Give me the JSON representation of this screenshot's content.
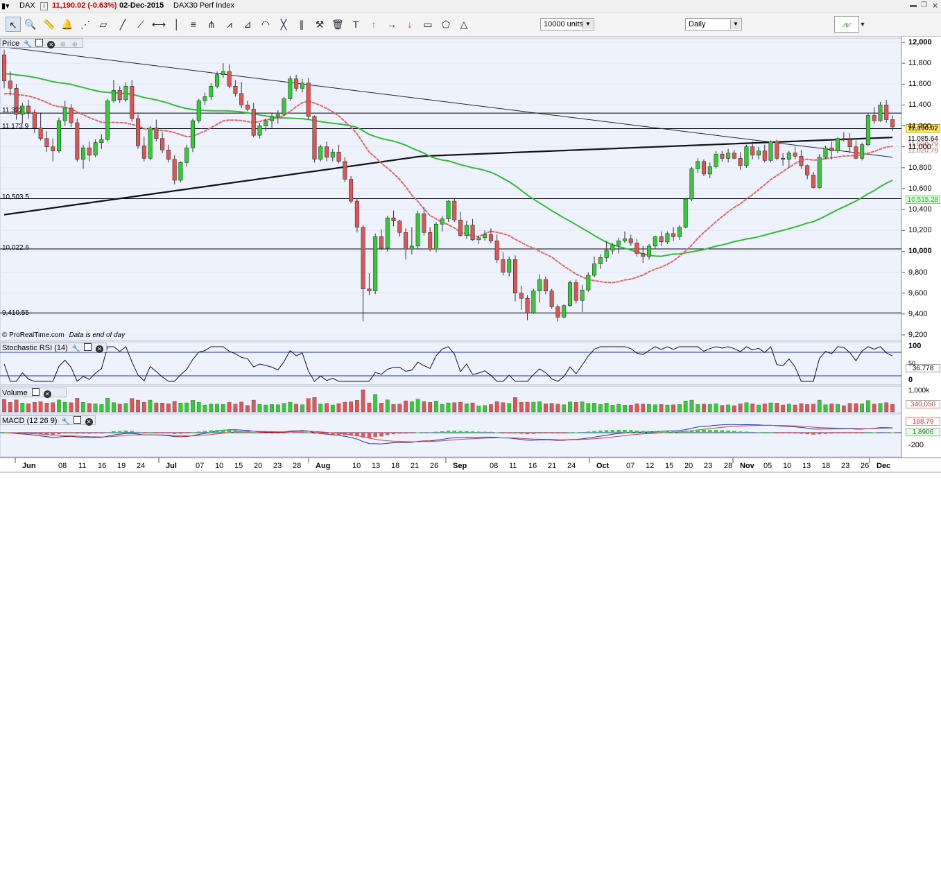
{
  "titlebar": {
    "symbol": "DAX",
    "price_change": "11,190.02 (-0.63%)",
    "date": "02-Dec-2015",
    "instrument": "DAX30 Perf Index"
  },
  "toolbar": {
    "units_value": "10000 units",
    "period_value": "Daily",
    "icons": [
      "pointer-icon",
      "zoom-icon",
      "ruler-icon",
      "alarm-bell-icon",
      "fibonacci-fan-icon",
      "channel-icon",
      "line-icon",
      "ray-icon",
      "horizontal-line-icon",
      "vertical-line-icon",
      "fibonacci-retracement-icon",
      "pitchfork-icon",
      "zigzag-icon",
      "gann-icon",
      "arc-icon",
      "crossing-line-icon",
      "parallel-lines-icon",
      "tools-icon",
      "trash-icon",
      "text-icon",
      "buy-arrow-icon",
      "right-arrow-icon",
      "sell-arrow-icon",
      "rectangle-icon",
      "polygon-icon",
      "triangle-icon"
    ]
  },
  "panels": {
    "price": {
      "label": "Price",
      "watermark": "© ProRealTime.com",
      "watermark_note": "Data is end of day"
    },
    "stoch": {
      "label": "Stochastic RSI (14)",
      "value": "36.778",
      "axis": [
        "100",
        "50",
        "0"
      ]
    },
    "volume": {
      "label": "Volume",
      "value": "340,050",
      "axis": [
        "1,000k"
      ]
    },
    "macd": {
      "label": "MACD (12 26 9)",
      "value1": "188.79",
      "value2": "1.8906",
      "axis": [
        "-200"
      ]
    }
  },
  "price_axis": [
    "12,000",
    "11,800",
    "11,600",
    "11,400",
    "11,200",
    "11,000",
    "10,800",
    "10,600",
    "10,400",
    "10,200",
    "10,000",
    "9,800",
    "9,600",
    "9,400",
    "9,200"
  ],
  "price_badges": {
    "last": "11,190.02",
    "ma200": "11,085.64",
    "ma20_hidden": "11,020.79",
    "ma20": "11,020.79",
    "ma50": "10,515.28"
  },
  "levels": [
    "11,322",
    "11,173.9",
    "10,503.5",
    "10,022.6",
    "9,410.55"
  ],
  "months": [
    "Jun",
    "Jul",
    "Aug",
    "Sep",
    "Oct",
    "Nov",
    "Dec"
  ],
  "days": [
    "08",
    "11",
    "16",
    "19",
    "24",
    "07",
    "10",
    "15",
    "20",
    "23",
    "28",
    "10",
    "13",
    "18",
    "21",
    "26",
    "08",
    "11",
    "16",
    "21",
    "24",
    "07",
    "12",
    "15",
    "20",
    "23",
    "28",
    "05",
    "10",
    "13",
    "18",
    "23",
    "26"
  ],
  "colors": {
    "up": "#33cc33",
    "down": "#e05555",
    "ma20": "#e06666",
    "ma50": "#33bb33",
    "ma200": "#111111",
    "panel_bg": "#eef2fc",
    "grid": "#e0e6f0"
  },
  "chart_data": {
    "type": "candlestick",
    "title": "DAX30 Perf Index",
    "ylim": [
      9200,
      12000
    ],
    "candles": [
      [
        11880,
        11930,
        11560,
        11630
      ],
      [
        11630,
        11720,
        11490,
        11560
      ],
      [
        11560,
        11600,
        11260,
        11310
      ],
      [
        11310,
        11420,
        11220,
        11390
      ],
      [
        11390,
        11450,
        11270,
        11330
      ],
      [
        11330,
        11360,
        11130,
        11180
      ],
      [
        11180,
        11320,
        11060,
        11080
      ],
      [
        11080,
        11150,
        10950,
        11000
      ],
      [
        11000,
        11080,
        10860,
        10960
      ],
      [
        10960,
        11280,
        10940,
        11250
      ],
      [
        11250,
        11440,
        11200,
        11370
      ],
      [
        11370,
        11410,
        11190,
        11230
      ],
      [
        11230,
        11270,
        10860,
        10880
      ],
      [
        10880,
        11020,
        10790,
        10990
      ],
      [
        10990,
        11050,
        10860,
        10920
      ],
      [
        10920,
        11070,
        10900,
        11040
      ],
      [
        11040,
        11120,
        10980,
        11070
      ],
      [
        11070,
        11460,
        11050,
        11440
      ],
      [
        11440,
        11640,
        11420,
        11540
      ],
      [
        11540,
        11580,
        11420,
        11450
      ],
      [
        11450,
        11620,
        11430,
        11580
      ],
      [
        11580,
        11640,
        11240,
        11270
      ],
      [
        11270,
        11310,
        10980,
        11010
      ],
      [
        11010,
        11100,
        10860,
        10890
      ],
      [
        10890,
        11200,
        10870,
        11180
      ],
      [
        11180,
        11260,
        11050,
        11080
      ],
      [
        11080,
        11140,
        10940,
        10970
      ],
      [
        10970,
        11020,
        10850,
        10880
      ],
      [
        10880,
        10920,
        10640,
        10680
      ],
      [
        10680,
        10860,
        10660,
        10850
      ],
      [
        10850,
        11020,
        10810,
        10990
      ],
      [
        10990,
        11270,
        10950,
        11250
      ],
      [
        11250,
        11460,
        11230,
        11440
      ],
      [
        11440,
        11520,
        11400,
        11480
      ],
      [
        11480,
        11610,
        11450,
        11580
      ],
      [
        11580,
        11720,
        11560,
        11690
      ],
      [
        11690,
        11800,
        11660,
        11720
      ],
      [
        11720,
        11790,
        11560,
        11580
      ],
      [
        11580,
        11640,
        11480,
        11510
      ],
      [
        11510,
        11620,
        11370,
        11400
      ],
      [
        11400,
        11440,
        11340,
        11360
      ],
      [
        11360,
        11420,
        11090,
        11110
      ],
      [
        11110,
        11230,
        11080,
        11200
      ],
      [
        11200,
        11270,
        11150,
        11250
      ],
      [
        11250,
        11320,
        11180,
        11290
      ],
      [
        11290,
        11350,
        11220,
        11310
      ],
      [
        11310,
        11480,
        11290,
        11460
      ],
      [
        11460,
        11680,
        11440,
        11650
      ],
      [
        11650,
        11690,
        11530,
        11560
      ],
      [
        11560,
        11650,
        11520,
        11610
      ],
      [
        11610,
        11660,
        11260,
        11290
      ],
      [
        11290,
        11300,
        10850,
        10880
      ],
      [
        10880,
        11020,
        10860,
        11000
      ],
      [
        11000,
        11050,
        10860,
        10900
      ],
      [
        10900,
        10980,
        10860,
        10950
      ],
      [
        10950,
        11020,
        10840,
        10860
      ],
      [
        10860,
        10900,
        10660,
        10690
      ],
      [
        10690,
        10720,
        10460,
        10480
      ],
      [
        10480,
        10500,
        10180,
        10230
      ],
      [
        10230,
        10250,
        9330,
        9640
      ],
      [
        9640,
        9790,
        9580,
        9620
      ],
      [
        9620,
        10170,
        9590,
        10140
      ],
      [
        10140,
        10210,
        10010,
        10030
      ],
      [
        10030,
        10340,
        10000,
        10320
      ],
      [
        10320,
        10390,
        10240,
        10290
      ],
      [
        10290,
        10300,
        10140,
        10180
      ],
      [
        10180,
        10220,
        9920,
        10020
      ],
      [
        10020,
        10230,
        9970,
        10050
      ],
      [
        10050,
        10390,
        10020,
        10360
      ],
      [
        10360,
        10420,
        10150,
        10180
      ],
      [
        10180,
        10230,
        10000,
        10020
      ],
      [
        10020,
        10280,
        9990,
        10260
      ],
      [
        10260,
        10340,
        10190,
        10310
      ],
      [
        10310,
        10490,
        10280,
        10480
      ],
      [
        10480,
        10500,
        10280,
        10300
      ],
      [
        10300,
        10380,
        10140,
        10150
      ],
      [
        10150,
        10290,
        10120,
        10250
      ],
      [
        10250,
        10310,
        10100,
        10110
      ],
      [
        10110,
        10150,
        10070,
        10130
      ],
      [
        10130,
        10200,
        10100,
        10160
      ],
      [
        10160,
        10220,
        10080,
        10100
      ],
      [
        10100,
        10160,
        9890,
        9920
      ],
      [
        9920,
        9990,
        9770,
        9800
      ],
      [
        9800,
        9950,
        9760,
        9920
      ],
      [
        9920,
        9960,
        9520,
        9600
      ],
      [
        9600,
        9670,
        9440,
        9550
      ],
      [
        9550,
        9580,
        9340,
        9410
      ],
      [
        9410,
        9640,
        9400,
        9620
      ],
      [
        9620,
        9780,
        9510,
        9730
      ],
      [
        9730,
        9760,
        9590,
        9620
      ],
      [
        9620,
        9640,
        9450,
        9470
      ],
      [
        9470,
        9490,
        9330,
        9370
      ],
      [
        9370,
        9490,
        9360,
        9480
      ],
      [
        9480,
        9720,
        9470,
        9700
      ],
      [
        9700,
        9730,
        9500,
        9530
      ],
      [
        9530,
        9680,
        9420,
        9630
      ],
      [
        9630,
        9800,
        9610,
        9770
      ],
      [
        9770,
        9950,
        9750,
        9880
      ],
      [
        9880,
        9970,
        9830,
        9940
      ],
      [
        9940,
        10100,
        9900,
        10010
      ],
      [
        10010,
        10080,
        9970,
        10060
      ],
      [
        10060,
        10130,
        9980,
        10100
      ],
      [
        10100,
        10190,
        10080,
        10120
      ],
      [
        10120,
        10160,
        10050,
        10080
      ],
      [
        10080,
        10120,
        9950,
        9980
      ],
      [
        9980,
        10050,
        9890,
        9950
      ],
      [
        9950,
        10070,
        9920,
        10050
      ],
      [
        10050,
        10150,
        10020,
        10140
      ],
      [
        10140,
        10190,
        10050,
        10090
      ],
      [
        10090,
        10190,
        10070,
        10170
      ],
      [
        10170,
        10230,
        10100,
        10140
      ],
      [
        10140,
        10250,
        10110,
        10230
      ],
      [
        10230,
        10510,
        10220,
        10500
      ],
      [
        10500,
        10810,
        10480,
        10790
      ],
      [
        10790,
        10890,
        10750,
        10860
      ],
      [
        10860,
        10880,
        10720,
        10740
      ],
      [
        10740,
        10850,
        10700,
        10810
      ],
      [
        10810,
        10960,
        10790,
        10930
      ],
      [
        10930,
        10960,
        10860,
        10890
      ],
      [
        10890,
        10980,
        10850,
        10940
      ],
      [
        10940,
        10970,
        10880,
        10890
      ],
      [
        10890,
        10950,
        10780,
        10820
      ],
      [
        10820,
        11020,
        10800,
        11000
      ],
      [
        11000,
        11050,
        10880,
        10920
      ],
      [
        10920,
        11000,
        10880,
        10960
      ],
      [
        10960,
        11020,
        10850,
        10870
      ],
      [
        10870,
        11060,
        10850,
        11050
      ],
      [
        11050,
        11070,
        10870,
        10890
      ],
      [
        10890,
        10940,
        10820,
        10880
      ],
      [
        10880,
        10960,
        10800,
        10940
      ],
      [
        10940,
        11000,
        10880,
        10910
      ],
      [
        10910,
        10970,
        10790,
        10820
      ],
      [
        10820,
        10830,
        10690,
        10730
      ],
      [
        10730,
        10760,
        10600,
        10610
      ],
      [
        10610,
        10930,
        10600,
        10900
      ],
      [
        10900,
        11010,
        10880,
        10990
      ],
      [
        10990,
        11050,
        10880,
        10960
      ],
      [
        10960,
        11090,
        10940,
        11080
      ],
      [
        11080,
        11140,
        11050,
        11070
      ],
      [
        11070,
        11130,
        10940,
        11000
      ],
      [
        11000,
        11060,
        10880,
        10890
      ],
      [
        10890,
        11040,
        10870,
        11020
      ],
      [
        11020,
        11320,
        11010,
        11300
      ],
      [
        11300,
        11380,
        11220,
        11250
      ],
      [
        11250,
        11430,
        11240,
        11400
      ],
      [
        11400,
        11450,
        11230,
        11260
      ],
      [
        11260,
        11300,
        11150,
        11190
      ]
    ]
  }
}
